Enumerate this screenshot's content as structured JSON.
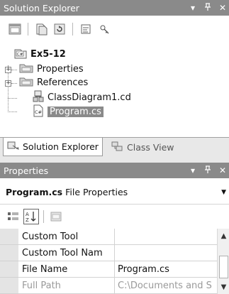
{
  "solution_explorer": {
    "title": "Solution Explorer",
    "dropdown_glyph": "▾",
    "pin_glyph": "ᵖ",
    "close_glyph": "✕",
    "toolbar_icons": [
      "properties-icon",
      "show-all-files-icon",
      "refresh-icon",
      "view-code-icon",
      "view-class-diagram-icon"
    ],
    "tree": {
      "project": "Ex5-12",
      "project_badge": "C#",
      "items": [
        {
          "label": "Properties",
          "icon": "folder-icon",
          "expandable": true
        },
        {
          "label": "References",
          "icon": "folder-icon",
          "expandable": true
        },
        {
          "label": "ClassDiagram1.cd",
          "icon": "class-diagram-icon",
          "expandable": false
        },
        {
          "label": "Program.cs",
          "icon": "cs-file-icon",
          "badge": "C#",
          "expandable": false,
          "selected": true
        }
      ]
    }
  },
  "bottom_tabs": [
    {
      "label": "Solution Explorer",
      "active": true
    },
    {
      "label": "Class View",
      "active": false
    }
  ],
  "properties": {
    "title": "Properties",
    "object_name": "Program.cs",
    "object_type": "File Properties",
    "rows": [
      {
        "name": "Custom Tool",
        "value": "",
        "enabled": true
      },
      {
        "name": "Custom Tool Nam",
        "value": "",
        "enabled": true
      },
      {
        "name": "File Name",
        "value": "Program.cs",
        "enabled": true
      },
      {
        "name": "Full Path",
        "value": "C:\\Documents and S",
        "enabled": false
      }
    ]
  },
  "colors": {
    "title_bar": "#8a8a8a",
    "selection": "#8a8a8a",
    "grid_gutter": "#e4e4e4"
  }
}
